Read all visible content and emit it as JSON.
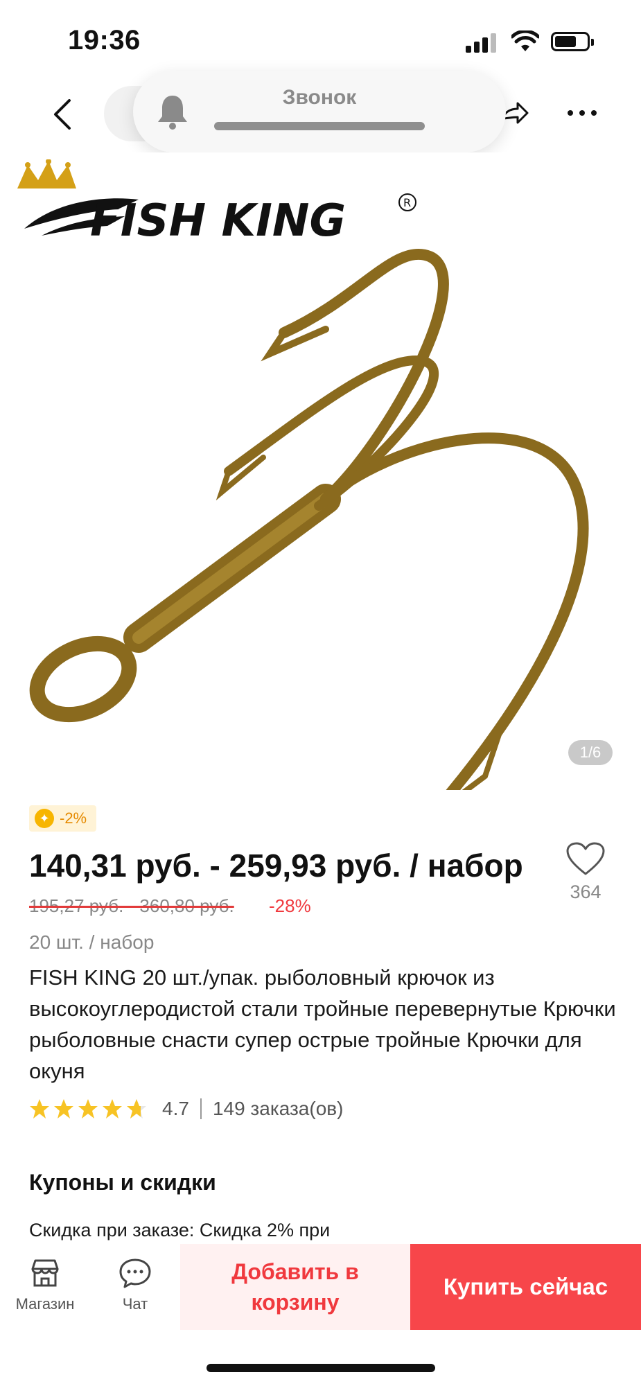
{
  "status_bar": {
    "time": "19:36"
  },
  "call_overlay": {
    "label": "Звонок"
  },
  "product_image": {
    "brand_logo_text": "FISH KING",
    "counter": "1/6"
  },
  "price_block": {
    "coin_discount": "-2%",
    "price_range": "140,31 руб. - 259,93 руб. / набор",
    "old_price": "195,27 руб. - 360,80 руб.",
    "discount": "-28%",
    "wishlist_count": "364"
  },
  "product": {
    "pack": "20 шт. / набор",
    "title": "FISH KING 20 шт./упак. рыболовный крючок из высокоуглеродистой стали тройные перевернутые Крючки рыболовные снасти супер острые тройные Крючки для окуня",
    "rating": "4.7",
    "stars": 4.7,
    "orders": "149 заказа(ов)"
  },
  "coupons": {
    "title": "Купоны и скидки",
    "line": "Скидка при заказе: Скидка 2% при"
  },
  "bottom_bar": {
    "store_label": "Магазин",
    "chat_label": "Чат",
    "add_to_cart_label": "Добавить в корзину",
    "buy_now_label": "Купить сейчас"
  },
  "colors": {
    "accent_red": "#f7464a",
    "discount_red": "#f0393e",
    "star_yellow": "#f7c324",
    "coin_yellow": "#f7b500"
  },
  "icons": [
    "back-icon",
    "share-icon",
    "more-icon",
    "bell-icon",
    "heart-icon",
    "star-icon",
    "store-icon",
    "chat-icon",
    "coin-icon"
  ]
}
